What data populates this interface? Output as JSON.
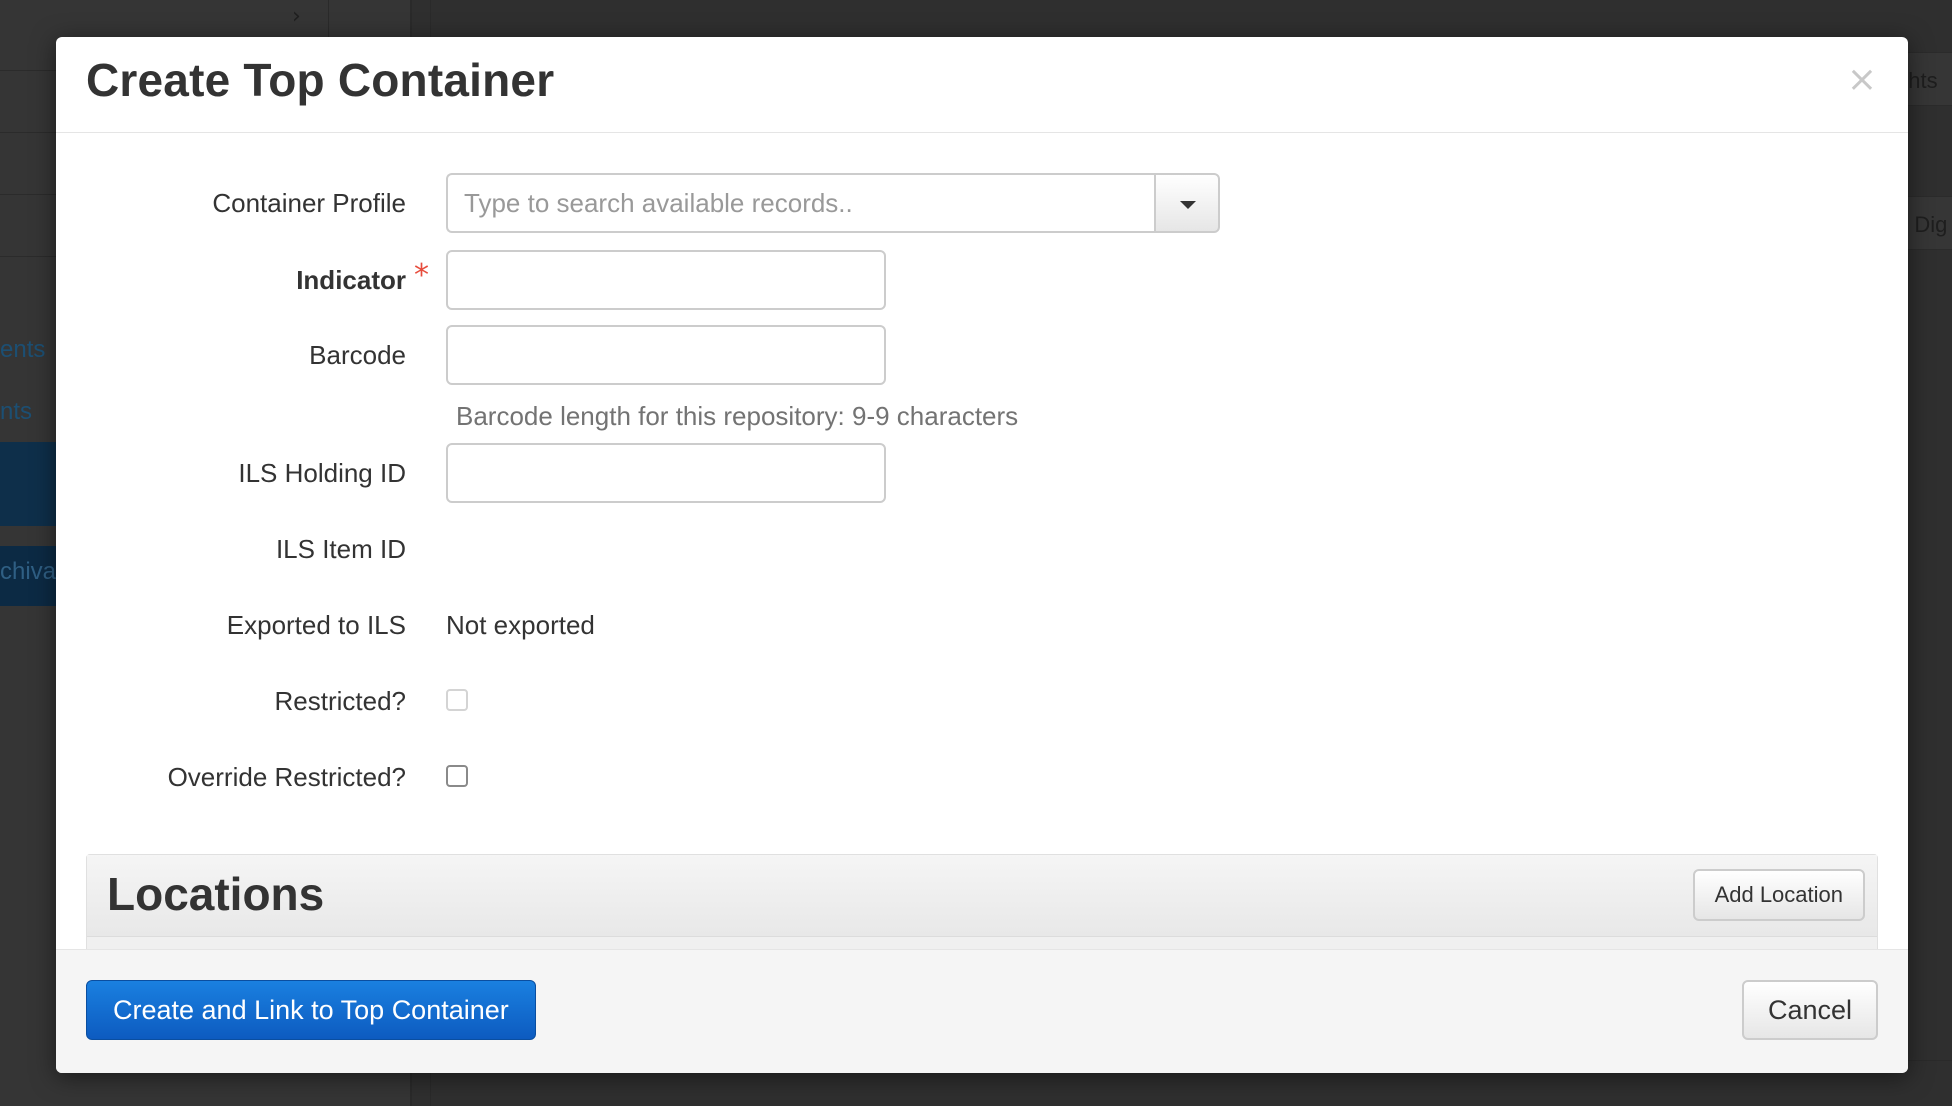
{
  "background": {
    "links": [
      "ents",
      "nts"
    ],
    "navy_text": "chival",
    "right_snippets": [
      "ghts",
      "d Dig"
    ]
  },
  "modal": {
    "title": "Create Top Container",
    "close_glyph": "×"
  },
  "form": {
    "container_profile": {
      "label": "Container Profile",
      "placeholder": "Type to search available records..",
      "value": ""
    },
    "indicator": {
      "label": "Indicator",
      "required_mark": "*",
      "value": ""
    },
    "barcode": {
      "label": "Barcode",
      "value": "",
      "help": "Barcode length for this repository: 9-9 characters"
    },
    "ils_holding_id": {
      "label": "ILS Holding ID",
      "value": ""
    },
    "ils_item_id": {
      "label": "ILS Item ID",
      "value": ""
    },
    "exported_to_ils": {
      "label": "Exported to ILS",
      "value": "Not exported"
    },
    "restricted": {
      "label": "Restricted?",
      "checked": false,
      "disabled": true
    },
    "override_restricted": {
      "label": "Override Restricted?",
      "checked": false
    }
  },
  "locations": {
    "title": "Locations",
    "add_button": "Add Location"
  },
  "footer": {
    "primary_button": "Create and Link to Top Container",
    "cancel_button": "Cancel"
  },
  "colors": {
    "primary": "#0d5bc0",
    "required": "#e74c3c",
    "overlay": "#2f2f2f"
  },
  "icons": [
    "close-icon",
    "caret-down-icon",
    "chevron-right-icon"
  ]
}
